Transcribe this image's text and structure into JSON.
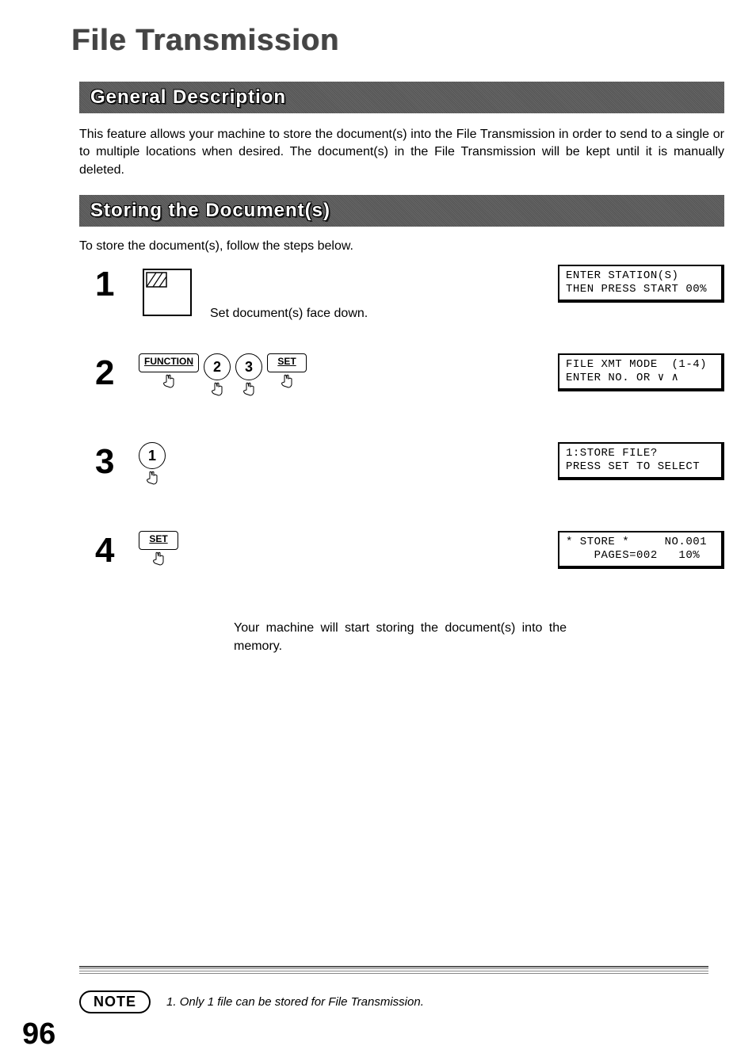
{
  "title": "File Transmission",
  "sections": {
    "general": {
      "heading": "General Description",
      "body": "This feature allows your machine to store the document(s) into the File Transmission in order to send to a single or to multiple locations when desired.  The document(s) in the File Transmission will be kept until it is manually deleted."
    },
    "storing": {
      "heading": "Storing the Document(s)",
      "intro": "To store the document(s), follow the steps below."
    }
  },
  "steps": [
    {
      "num": "1",
      "caption": "Set document(s) face down.",
      "lcd": "ENTER STATION(S)\nTHEN PRESS START 00%"
    },
    {
      "num": "2",
      "buttons": {
        "function": "FUNCTION",
        "k2": "2",
        "k3": "3",
        "set": "SET"
      },
      "lcd": "FILE XMT MODE  (1-4)\nENTER NO. OR ∨ ∧"
    },
    {
      "num": "3",
      "buttons": {
        "k1": "1"
      },
      "lcd": "1:STORE FILE?\nPRESS SET TO SELECT"
    },
    {
      "num": "4",
      "buttons": {
        "set": "SET"
      },
      "after": "Your machine will start storing the document(s) into the memory.",
      "lcd": "* STORE *     NO.001\n    PAGES=002   10%"
    }
  ],
  "note": {
    "label": "NOTE",
    "text": "1. Only 1 file can be stored for File Transmission."
  },
  "page_number": "96"
}
